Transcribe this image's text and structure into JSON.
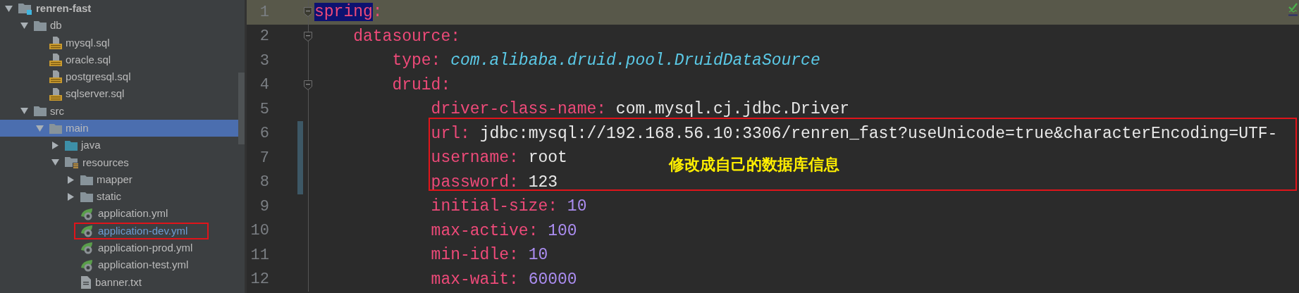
{
  "project_tree": {
    "items": [
      {
        "name": "renren-fast",
        "kind": "module",
        "expanded": true,
        "selected": false,
        "children": [
          {
            "name": "db",
            "kind": "folder",
            "expanded": true,
            "selected": false,
            "children": [
              {
                "name": "mysql.sql",
                "kind": "sql",
                "selected": false,
                "modified": false,
                "boxed": false
              },
              {
                "name": "oracle.sql",
                "kind": "sql",
                "selected": false,
                "modified": false,
                "boxed": false
              },
              {
                "name": "postgresql.sql",
                "kind": "sql",
                "selected": false,
                "modified": false,
                "boxed": false
              },
              {
                "name": "sqlserver.sql",
                "kind": "sql",
                "selected": false,
                "modified": false,
                "boxed": false
              }
            ]
          },
          {
            "name": "src",
            "kind": "folder",
            "expanded": true,
            "selected": false,
            "children": [
              {
                "name": "main",
                "kind": "folder",
                "expanded": true,
                "selected": true,
                "children": [
                  {
                    "name": "java",
                    "kind": "source",
                    "expanded": false,
                    "selected": false
                  },
                  {
                    "name": "resources",
                    "kind": "resources",
                    "expanded": true,
                    "selected": false,
                    "children": [
                      {
                        "name": "mapper",
                        "kind": "folder",
                        "expanded": false,
                        "selected": false
                      },
                      {
                        "name": "static",
                        "kind": "folder",
                        "expanded": false,
                        "selected": false
                      },
                      {
                        "name": "application.yml",
                        "kind": "yml",
                        "selected": false,
                        "modified": false,
                        "boxed": false
                      },
                      {
                        "name": "application-dev.yml",
                        "kind": "yml",
                        "selected": false,
                        "modified": true,
                        "boxed": true
                      },
                      {
                        "name": "application-prod.yml",
                        "kind": "yml",
                        "selected": false,
                        "modified": false,
                        "boxed": false
                      },
                      {
                        "name": "application-test.yml",
                        "kind": "yml",
                        "selected": false,
                        "modified": false,
                        "boxed": false
                      },
                      {
                        "name": "banner.txt",
                        "kind": "txt",
                        "selected": false,
                        "modified": false,
                        "boxed": false
                      }
                    ]
                  }
                ]
              }
            ]
          }
        ]
      }
    ]
  },
  "editor": {
    "annotation": {
      "text": "修改成自己的数据库信息"
    },
    "lines": [
      {
        "number": "1",
        "key": "spring",
        "separator": ":",
        "current": true,
        "key_selected": true,
        "changed": false,
        "boxed": false,
        "children": [
          {
            "number": "2",
            "key": "datasource",
            "separator": ":",
            "current": false,
            "key_selected": false,
            "changed": false,
            "boxed": false,
            "children": [
              {
                "number": "3",
                "key": "type",
                "separator": ":",
                "value": "com.alibaba.druid.pool.DruidDataSource",
                "kind": "class",
                "current": false,
                "key_selected": false,
                "changed": false,
                "boxed": false
              },
              {
                "number": "4",
                "key": "druid",
                "separator": ":",
                "current": false,
                "key_selected": false,
                "changed": false,
                "boxed": false,
                "children": [
                  {
                    "number": "5",
                    "key": "driver-class-name",
                    "separator": ":",
                    "value": "com.mysql.cj.jdbc.Driver",
                    "kind": "plain",
                    "current": false,
                    "key_selected": false,
                    "changed": false,
                    "boxed": false
                  },
                  {
                    "number": "6",
                    "key": "url",
                    "separator": ":",
                    "value": "jdbc:mysql://192.168.56.10:3306/renren_fast?useUnicode=true&characterEncoding=UTF-",
                    "kind": "plain",
                    "current": false,
                    "key_selected": false,
                    "changed": true,
                    "boxed": true
                  },
                  {
                    "number": "7",
                    "key": "username",
                    "separator": ":",
                    "value": "root",
                    "kind": "plain",
                    "current": false,
                    "key_selected": false,
                    "changed": true,
                    "boxed": true
                  },
                  {
                    "number": "8",
                    "key": "password",
                    "separator": ":",
                    "value": "123",
                    "kind": "plain",
                    "current": false,
                    "key_selected": false,
                    "changed": true,
                    "boxed": true
                  },
                  {
                    "number": "9",
                    "key": "initial-size",
                    "separator": ":",
                    "value": "10",
                    "kind": "number",
                    "current": false,
                    "key_selected": false,
                    "changed": false,
                    "boxed": false
                  },
                  {
                    "number": "10",
                    "key": "max-active",
                    "separator": ":",
                    "value": "100",
                    "kind": "number",
                    "current": false,
                    "key_selected": false,
                    "changed": false,
                    "boxed": false
                  },
                  {
                    "number": "11",
                    "key": "min-idle",
                    "separator": ":",
                    "value": "10",
                    "kind": "number",
                    "current": false,
                    "key_selected": false,
                    "changed": false,
                    "boxed": false
                  },
                  {
                    "number": "12",
                    "key": "max-wait",
                    "separator": ":",
                    "value": "60000",
                    "kind": "number",
                    "current": false,
                    "key_selected": false,
                    "changed": false,
                    "boxed": false
                  }
                ]
              }
            ]
          }
        ]
      }
    ]
  }
}
